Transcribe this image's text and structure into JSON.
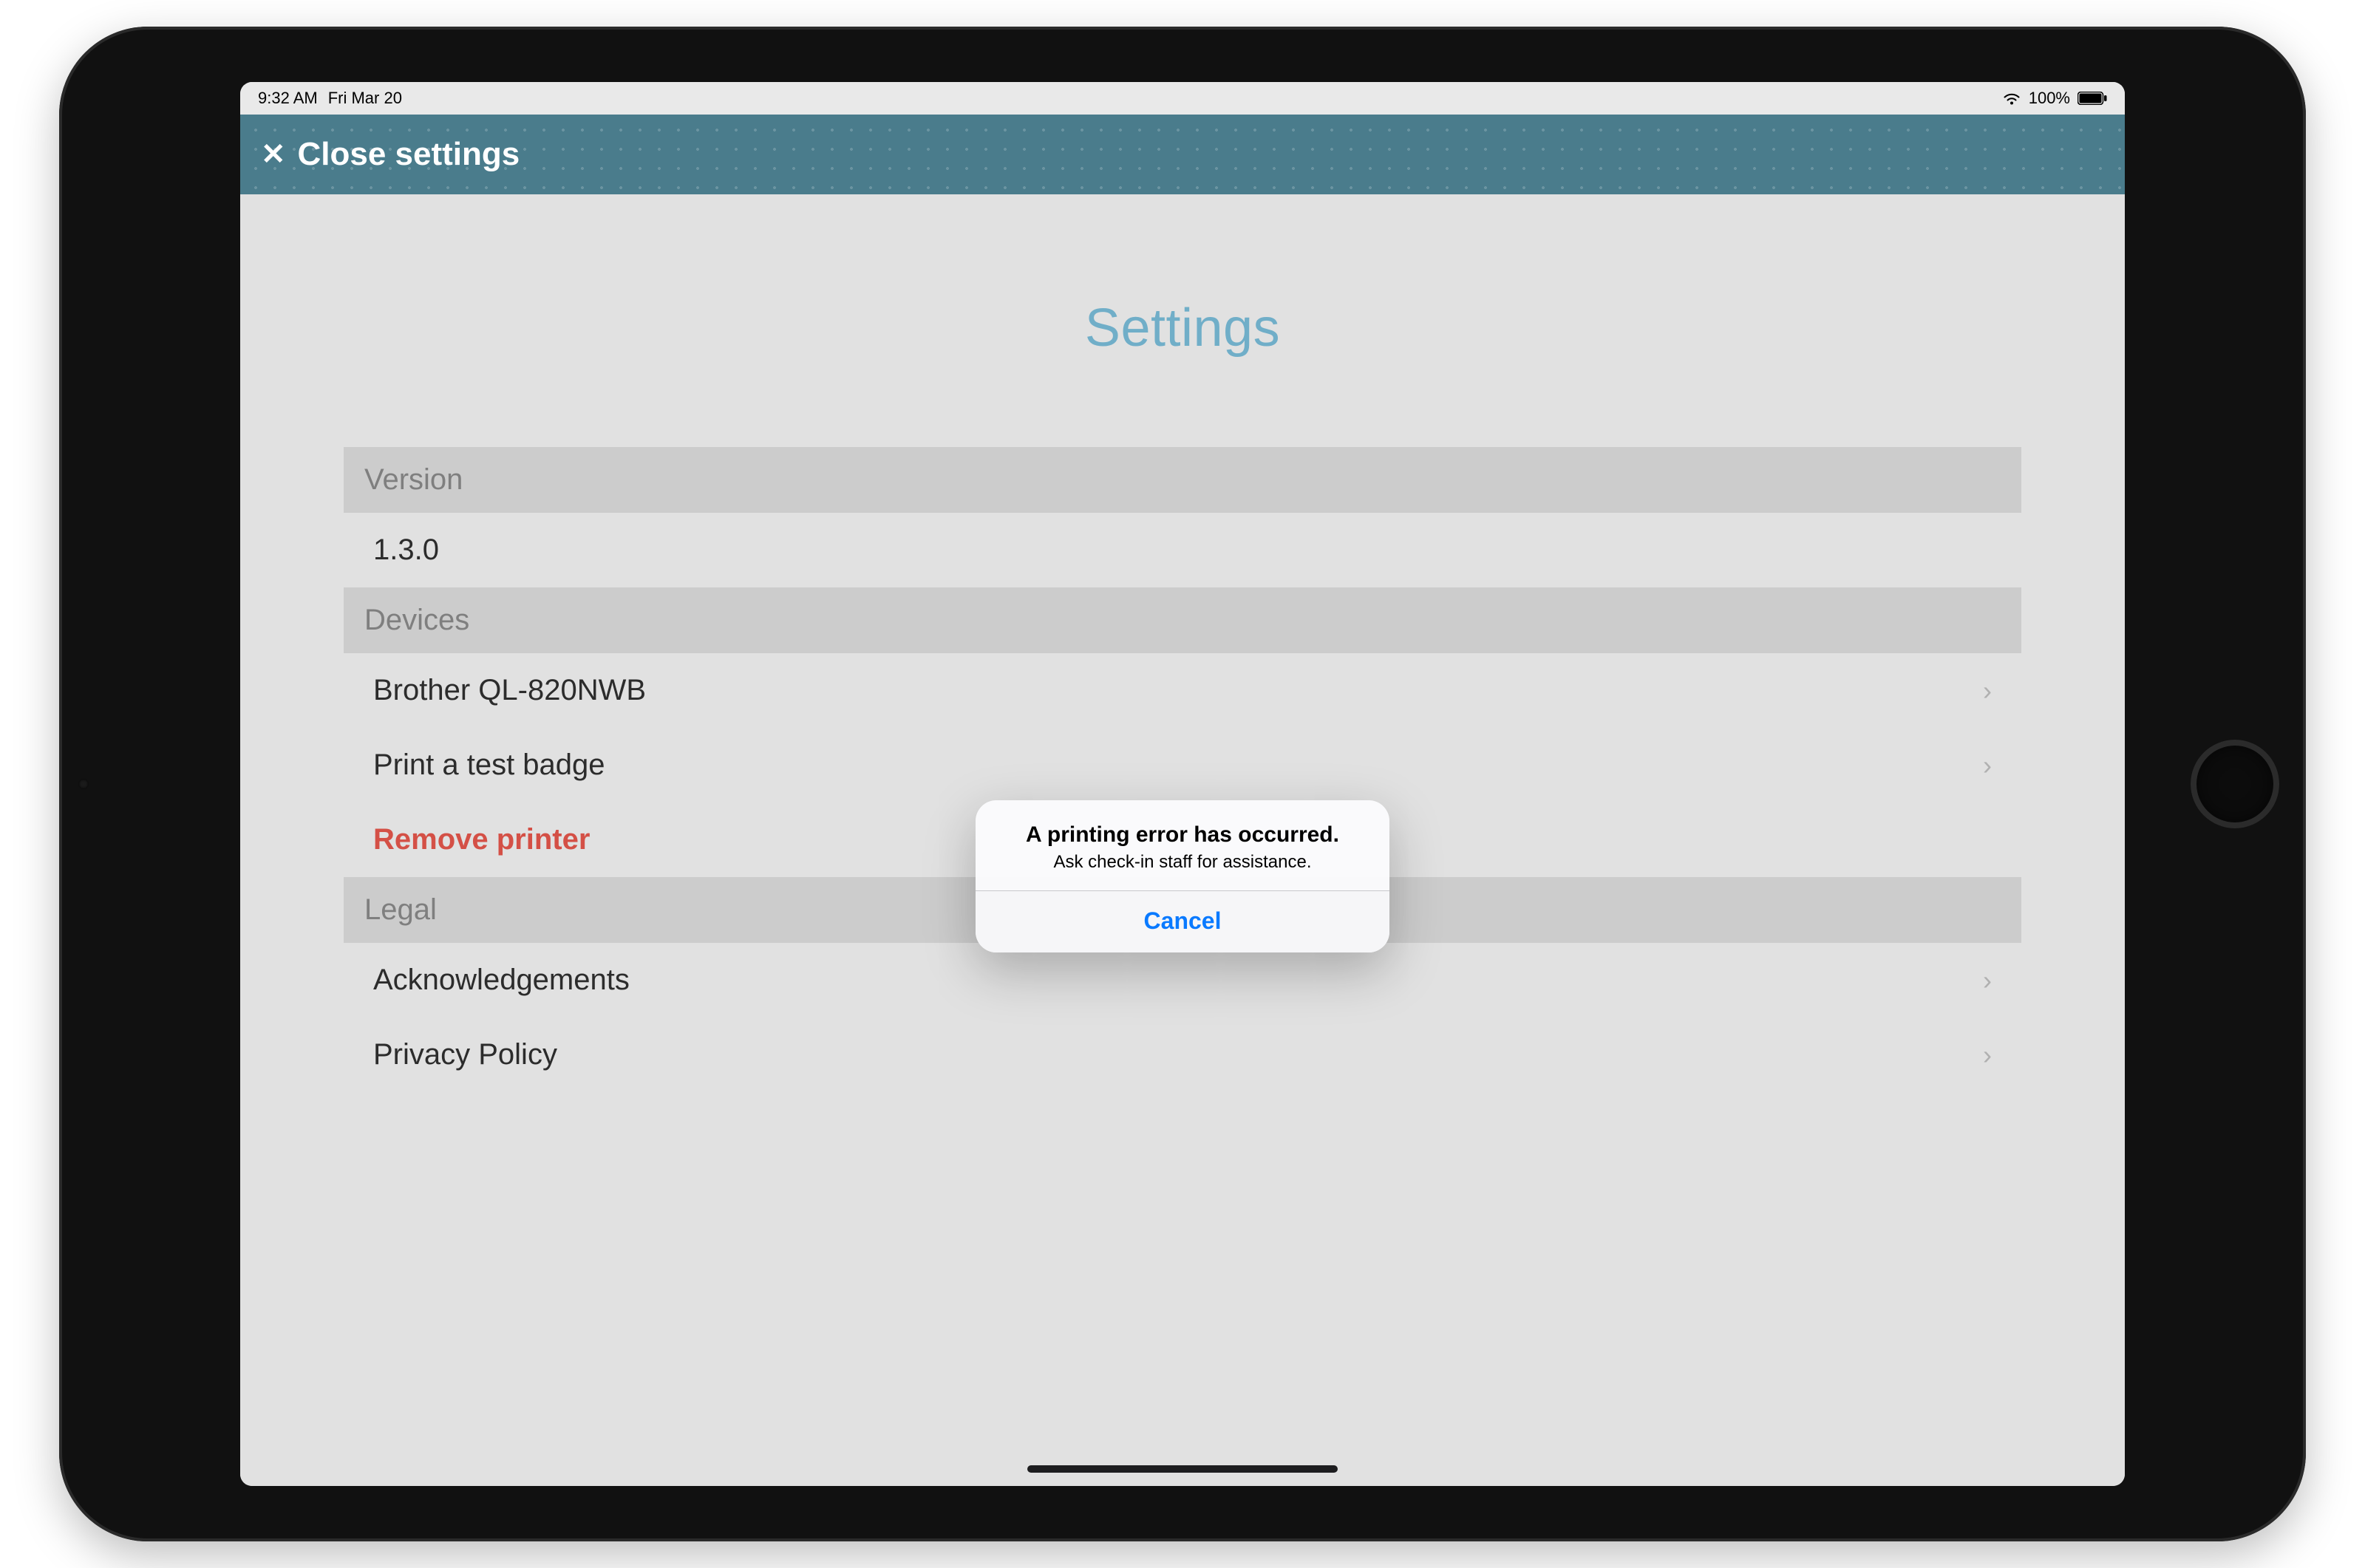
{
  "status": {
    "time": "9:32 AM",
    "date": "Fri Mar 20",
    "battery_pct": "100%"
  },
  "nav": {
    "close_label": "Close settings"
  },
  "page": {
    "title": "Settings"
  },
  "sections": {
    "version": {
      "header": "Version",
      "value": "1.3.0"
    },
    "devices": {
      "header": "Devices",
      "printer": "Brother QL-820NWB",
      "test_badge": "Print a test badge",
      "remove": "Remove printer"
    },
    "legal": {
      "header": "Legal",
      "ack": "Acknowledgements",
      "privacy": "Privacy Policy"
    }
  },
  "alert": {
    "title": "A printing error has occurred.",
    "message": "Ask check-in staff for assistance.",
    "cancel": "Cancel"
  }
}
